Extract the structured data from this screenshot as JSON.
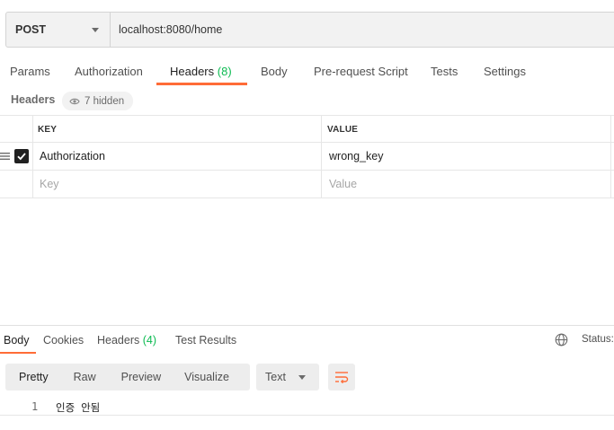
{
  "request": {
    "method": "POST",
    "url": "localhost:8080/home"
  },
  "request_tabs": {
    "params": "Params",
    "authorization": "Authorization",
    "headers": "Headers",
    "headers_count": "(8)",
    "body": "Body",
    "prerequest": "Pre-request Script",
    "tests": "Tests",
    "settings": "Settings"
  },
  "headers_section": {
    "title": "Headers",
    "hidden": "7 hidden"
  },
  "table": {
    "columns": {
      "key": "KEY",
      "value": "VALUE"
    },
    "rows": [
      {
        "key": "Authorization",
        "value": "wrong_key",
        "checked": true
      }
    ],
    "placeholder": {
      "key": "Key",
      "value": "Value"
    }
  },
  "response_tabs": {
    "body": "Body",
    "cookies": "Cookies",
    "headers": "Headers",
    "headers_count": "(4)",
    "test_results": "Test Results",
    "status": "Status:"
  },
  "format_toolbar": {
    "pretty": "Pretty",
    "raw": "Raw",
    "preview": "Preview",
    "visualize": "Visualize",
    "type": "Text"
  },
  "response_body": {
    "line_number": "1",
    "line_text": "인증 안됨"
  },
  "colors": {
    "accent": "#ff6c37",
    "count_green": "#0cbb52"
  },
  "icons": [
    "chevron-down-icon",
    "eye-icon",
    "drag-handle-icon",
    "checkbox-checked-icon",
    "globe-icon",
    "wrap-lines-icon"
  ]
}
